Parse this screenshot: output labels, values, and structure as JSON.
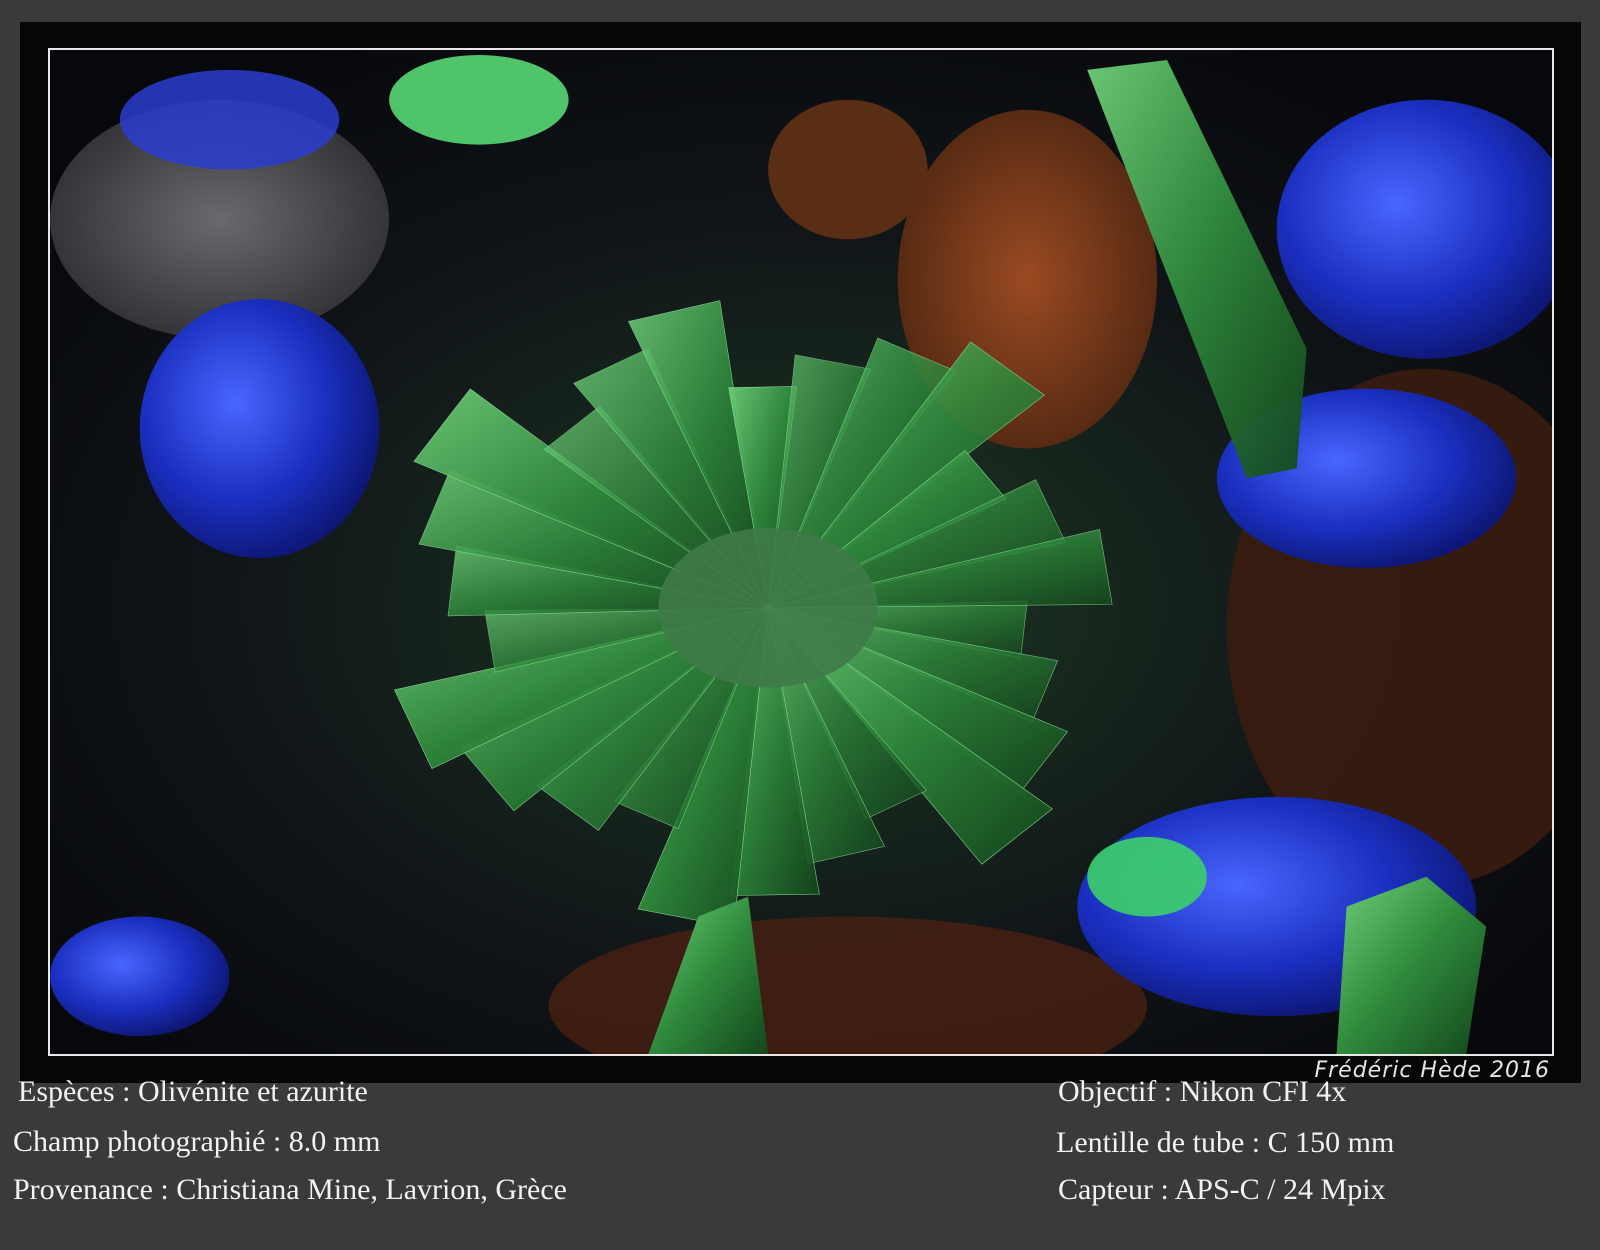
{
  "photo": {
    "description_icon": "mineral-photo",
    "colors": {
      "olivenite": "#2f8a3c",
      "azurite": "#1a2fbf",
      "matrix": "#6b3518",
      "background": "#0b0d12"
    }
  },
  "signature": "Frédéric Hède 2016",
  "captions": {
    "species": "Espèces : Olivénite et azurite",
    "field": "Champ photographié : 8.0 mm",
    "origin": "Provenance : Christiana Mine, Lavrion, Grèce",
    "objective": "Objectif : Nikon CFI 4x",
    "tube_lens": "Lentille de tube : C 150 mm",
    "sensor": "Capteur : APS-C / 24 Mpix"
  }
}
